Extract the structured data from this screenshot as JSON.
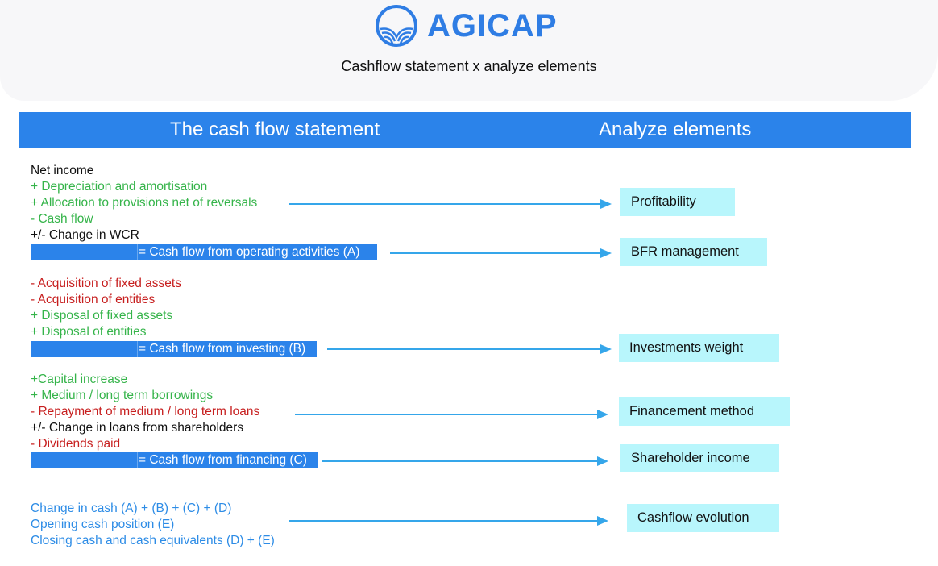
{
  "header": {
    "brand": "AGICAP",
    "subtitle": "Cashflow statement x analyze elements",
    "logo_icon": "agicap-logo-icon"
  },
  "banner": {
    "left": "The cash flow statement",
    "right": "Analyze elements"
  },
  "colors": {
    "brand_blue": "#2f7de4",
    "banner_blue": "#2b83ea",
    "green": "#35b44a",
    "red": "#c71f1f",
    "link_blue": "#2d8ce6",
    "box_cyan": "#b8f6fc",
    "arrow": "#35a6ea"
  },
  "statement": {
    "operating": {
      "lines": [
        {
          "text": "Net income",
          "tone": "black"
        },
        {
          "text": "+ Depreciation and amortisation",
          "tone": "green"
        },
        {
          "text": "+ Allocation to provisions net of reversals",
          "tone": "green"
        },
        {
          "text": "- Cash flow",
          "tone": "green"
        },
        {
          "text": "+/- Change in WCR",
          "tone": "black"
        }
      ],
      "total": "= Cash flow from operating activities (A)"
    },
    "investing": {
      "lines": [
        {
          "text": "- Acquisition of fixed assets",
          "tone": "red"
        },
        {
          "text": "- Acquisition of entities",
          "tone": "red"
        },
        {
          "text": "+ Disposal of fixed assets",
          "tone": "green"
        },
        {
          "text": "+ Disposal of entities",
          "tone": "green"
        }
      ],
      "total": "= Cash flow from investing (B)"
    },
    "financing": {
      "lines": [
        {
          "text": "+Capital increase",
          "tone": "green"
        },
        {
          "text": "+ Medium / long term borrowings",
          "tone": "green"
        },
        {
          "text": "- Repayment of medium / long term loans",
          "tone": "red"
        },
        {
          "text": "+/- Change in loans from shareholders",
          "tone": "black"
        },
        {
          "text": "- Dividends paid",
          "tone": "red"
        }
      ],
      "total": "= Cash flow from financing (C)"
    },
    "summary": {
      "lines": [
        {
          "text": "Change in cash (A) + (B) + (C) + (D)",
          "tone": "blue"
        },
        {
          "text": "Opening cash position (E)",
          "tone": "blue"
        },
        {
          "text": "Closing cash and cash equivalents (D) + (E)",
          "tone": "blue"
        }
      ]
    }
  },
  "analyze": [
    {
      "label": "Profitability",
      "from": "+ Allocation to provisions net of reversals"
    },
    {
      "label": "BFR management",
      "from": "= Cash flow from operating activities (A)"
    },
    {
      "label": "Investments weight",
      "from": "= Cash flow from investing (B)"
    },
    {
      "label": "Financement method",
      "from": "- Repayment of medium / long term loans"
    },
    {
      "label": "Shareholder income",
      "from": "= Cash flow from financing (C)"
    },
    {
      "label": "Cashflow evolution",
      "from": "Opening cash position (E)"
    }
  ]
}
